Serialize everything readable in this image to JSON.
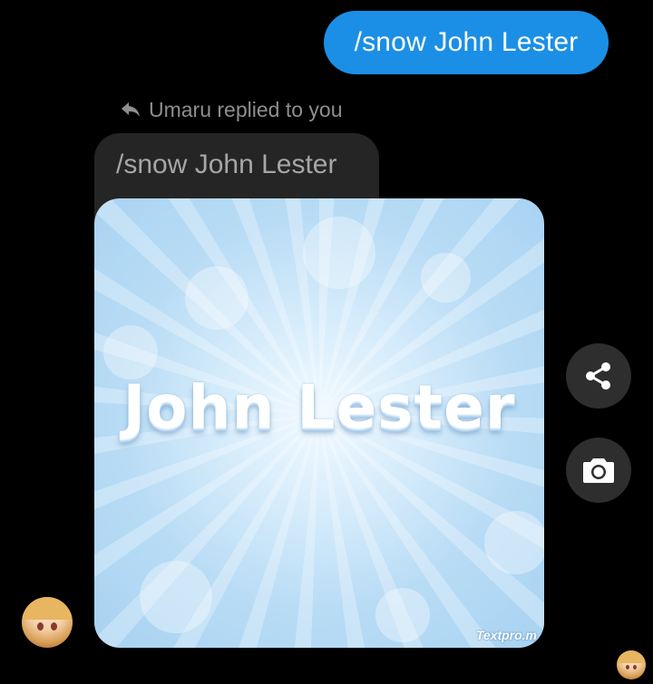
{
  "conversation": {
    "sent_message": "/snow John Lester",
    "reply_indicator": "Umaru replied to you",
    "quoted_message": "/snow John Lester",
    "image": {
      "text": "John Lester",
      "watermark": "Textpro.m"
    }
  },
  "actions": {
    "share_icon": "share-icon",
    "camera_icon": "camera-icon"
  },
  "colors": {
    "background": "#000000",
    "sent_bubble": "#1b8fe6",
    "quoted_bubble": "#252525",
    "action_button": "#2e2e2e"
  }
}
